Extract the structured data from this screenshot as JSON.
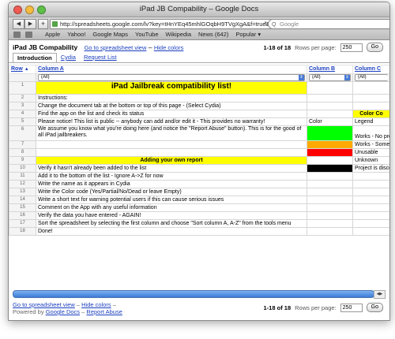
{
  "browser": {
    "title": "iPad JB Compability – Google Docs",
    "url": "http://spreadsheets.google.com/lv?key=tHnYEq45mhlGOqbH9TVgXgA&f=true&gid=8",
    "search_placeholder": "Google",
    "bookmarks": [
      "Apple",
      "Yahoo!",
      "Google Maps",
      "YouTube",
      "Wikipedia",
      "News (642)",
      "Popular"
    ]
  },
  "header": {
    "doc_title": "iPad JB Compability",
    "link_spreadsheet_view": "Go to spreadsheet view",
    "separator": "–",
    "link_hide_colors": "Hide colors"
  },
  "pager": {
    "range": "1-18 of 18",
    "rows_label": "Rows per page:",
    "rows_value": "250",
    "go_label": "Go"
  },
  "tabs": [
    "Introduction",
    "Cydia",
    "Request List"
  ],
  "columns": [
    "Row",
    "Column A",
    "Column B",
    "Column C"
  ],
  "sort_arrow": "▲",
  "filter_value": "(All)",
  "rows": [
    {
      "num": "1",
      "a": "iPad Jailbreak compatibility list!",
      "b": "",
      "c": ""
    },
    {
      "num": "2",
      "a": "Instructions:",
      "b": "",
      "c": ""
    },
    {
      "num": "3",
      "a": "Change the document tab at the bottom or top of this page - (Select Cydia)",
      "b": "",
      "c": ""
    },
    {
      "num": "4",
      "a": "Find the app on the list and check its status",
      "b": "",
      "c": "Color Co"
    },
    {
      "num": "5",
      "a": "Please notice! This list is public -- anybody can add and/or edit it - This provides no warranty!",
      "b": "Color",
      "c": "Legend"
    },
    {
      "num": "6",
      "a": "We assume you know what you're doing here (and notice the \"Report Abuse\" button). This is for the good of all iPad jailbreakers.",
      "b": "",
      "c": "Works - No prob"
    },
    {
      "num": "7",
      "a": "",
      "b": "",
      "c": "Works - Some p"
    },
    {
      "num": "8",
      "a": "",
      "b": "",
      "c": "Unusable"
    },
    {
      "num": "9",
      "a": "Adding your own report",
      "b": "",
      "c": "Unknown"
    },
    {
      "num": "10",
      "a": "Verify it hasn't already been added to the list",
      "b": "",
      "c": "Project is disco"
    },
    {
      "num": "11",
      "a": "Add it to the bottom of the list - Ignore A->Z for now",
      "b": "",
      "c": ""
    },
    {
      "num": "12",
      "a": "Write the name as it appears in Cydia",
      "b": "",
      "c": ""
    },
    {
      "num": "13",
      "a": "Write the Color code (Yes/Partial/No/Dead or leave Empty)",
      "b": "",
      "c": ""
    },
    {
      "num": "14",
      "a": "Write a short text for warning potential users if this can cause serious issues",
      "b": "",
      "c": ""
    },
    {
      "num": "15",
      "a": "Comment on the App with any useful information",
      "b": "",
      "c": ""
    },
    {
      "num": "16",
      "a": "Verify the data you have entered - AGAIN!",
      "b": "",
      "c": ""
    },
    {
      "num": "17",
      "a": "Sort the spreadsheet by selecting the first column and choose \"Sort column A, A-Z\" from the tools menu",
      "b": "",
      "c": ""
    },
    {
      "num": "18",
      "a": "Done!",
      "b": "",
      "c": ""
    }
  ],
  "footer": {
    "link_spreadsheet_view": "Go to spreadsheet view",
    "sep": "–",
    "link_hide_colors": "Hide colors",
    "powered_by": "Powered by",
    "google_docs": "Google Docs",
    "report_abuse": "Report Abuse"
  },
  "colors": {
    "title_bg": "#ffff00",
    "works": "#00ff00",
    "partial": "#ffaa00",
    "unusable": "#ff0000",
    "discontinued": "#000000",
    "link": "#1a3fbf"
  }
}
